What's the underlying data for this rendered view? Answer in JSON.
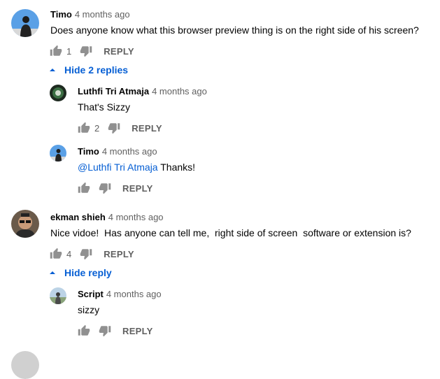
{
  "comments": [
    {
      "author": "Timo",
      "time": "4 months ago",
      "text": "Does anyone know what this browser preview thing is on the right side of his screen?",
      "likes": "1",
      "reply_label": "REPLY",
      "toggle_label": "Hide 2 replies",
      "replies": [
        {
          "author": "Luthfi Tri Atmaja",
          "time": "4 months ago",
          "text": "That's Sizzy",
          "likes": "2",
          "reply_label": "REPLY"
        },
        {
          "author": "Timo",
          "time": "4 months ago",
          "mention": "@Luthfi Tri Atmaja",
          "text": " Thanks!",
          "reply_label": "REPLY"
        }
      ]
    },
    {
      "author": "ekman shieh",
      "time": "4 months ago",
      "text": "Nice vidoe!  Has anyone can tell me,  right side of screen  software or extension is?",
      "likes": "4",
      "reply_label": "REPLY",
      "toggle_label": "Hide reply",
      "replies": [
        {
          "author": "Script",
          "time": "4 months ago",
          "text": "sizzy",
          "reply_label": "REPLY"
        }
      ]
    }
  ],
  "colors": {
    "link": "#065fd4",
    "muted": "#606060",
    "text": "#030303"
  },
  "icons": {
    "like": "thumb-up-icon",
    "dislike": "thumb-down-icon",
    "toggle": "caret-up-icon"
  }
}
